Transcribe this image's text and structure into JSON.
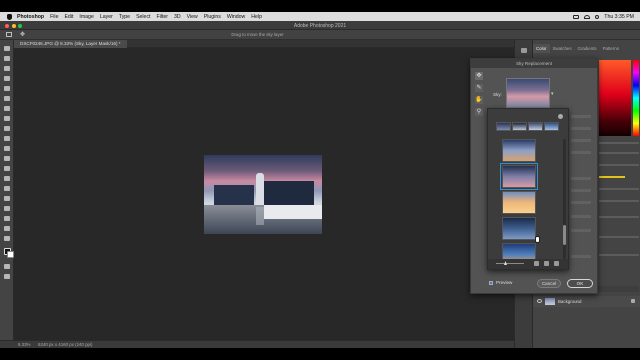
{
  "menubar": {
    "app": "Photoshop",
    "items": [
      "File",
      "Edit",
      "Image",
      "Layer",
      "Type",
      "Select",
      "Filter",
      "3D",
      "View",
      "Plugins",
      "Window",
      "Help"
    ],
    "clock": "Thu 3:35 PM"
  },
  "window": {
    "title": "Adobe Photoshop 2021"
  },
  "options": {
    "hint": "Drag to move the sky layer"
  },
  "document": {
    "tab": "DSCF0246.JPG @ 8.33% (Sky, Layer Mask/16) *",
    "zoom": "8.33%",
    "info": "6240 px x 4160 px (240 ppi)"
  },
  "panels": {
    "tabs": [
      "Color",
      "Swatches",
      "Gradients",
      "Patterns"
    ],
    "layer_name": "Background",
    "colors": {
      "accent_yellow": "#e3c21b",
      "selection_blue": "#2e8ed6"
    }
  },
  "dialog": {
    "title": "Sky Replacement",
    "sky_label": "Sky:",
    "preview_label": "Preview",
    "cancel_label": "Cancel",
    "ok_label": "OK",
    "tools": [
      "move-sky-icon",
      "sky-brush-icon",
      "hand-icon",
      "zoom-icon"
    ]
  },
  "sky_picker": {
    "top_strip": [
      {
        "gradient": [
          "#2c3556",
          "#7e8db4"
        ]
      },
      {
        "gradient": [
          "#1e2840",
          "#bcc6d8"
        ]
      },
      {
        "gradient": [
          "#3a4c70",
          "#c3cde0"
        ]
      },
      {
        "gradient": [
          "#2d4f86",
          "#a7c1e3"
        ]
      }
    ],
    "thumbs": [
      {
        "gradient": [
          "#2b3c66",
          "#8ea0c8",
          "#d7a36e"
        ],
        "selected": false
      },
      {
        "gradient": [
          "#23304f",
          "#7d7fa8",
          "#d99aa3"
        ],
        "selected": true
      },
      {
        "gradient": [
          "#6f8fbf",
          "#f0b67a",
          "#f7d28e"
        ],
        "selected": false
      },
      {
        "gradient": [
          "#1b2a4a",
          "#3f5f8f",
          "#7c9bc6"
        ],
        "selected": false
      },
      {
        "gradient": [
          "#1f3d7a",
          "#4f7fc0",
          "#f2a24b"
        ],
        "selected": false
      }
    ]
  }
}
